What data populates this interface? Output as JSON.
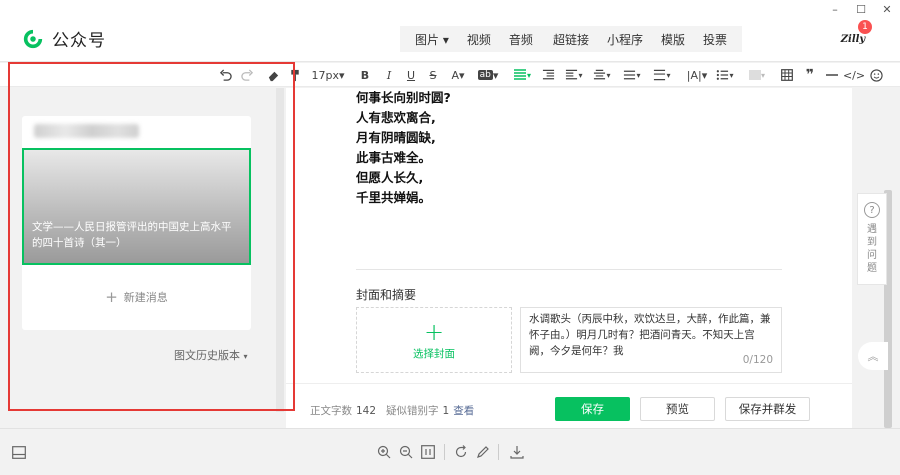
{
  "window": {
    "controls": [
      "–",
      "☐",
      "✕"
    ]
  },
  "header": {
    "app_name": "公众号",
    "media_group_1": [
      "图片",
      "视频",
      "音频"
    ],
    "media_group_2": [
      "超链接",
      "小程序",
      "模版",
      "投票"
    ],
    "avatar_text": "Zilly",
    "notification_count": "1"
  },
  "toolbar": {
    "font_size": "17px",
    "icons": [
      "undo-icon",
      "redo-icon",
      "eraser-icon",
      "format-painter-icon",
      "bold-icon",
      "italic-icon",
      "underline-icon",
      "strikethrough-icon",
      "font-color-icon",
      "highlight-icon",
      "align-left-icon",
      "indent-icon",
      "outdent-icon",
      "align-center-icon",
      "line-spacing-icon",
      "paragraph-spacing-icon",
      "letter-spacing-icon",
      "list-icon",
      "background-icon",
      "table-icon",
      "quote-icon",
      "divider-icon",
      "code-icon",
      "emoji-icon"
    ]
  },
  "sidebar": {
    "article_title": "文学——人民日报管评出的中国史上高水平的四十首诗（其一）",
    "new_message": "新建消息",
    "history": "图文历史版本"
  },
  "editor": {
    "poem_lines": [
      "何事长向别时圆?",
      "人有悲欢离合,",
      "月有阴晴圆缺,",
      "此事古难全。",
      "但愿人长久,",
      "千里共婵娟。"
    ],
    "cover_section_label": "封面和摘要",
    "select_cover": "选择封面",
    "summary_text": "水调歌头（丙辰中秋，欢饮达旦，大醉，作此篇，兼怀子由。）明月几时有？把酒问青天。不知天上宫阙，今夕是何年？我",
    "summary_count": "0/120"
  },
  "footer": {
    "word_count_label": "正文字数",
    "word_count": "142",
    "typo_label": "疑似错别字",
    "typo_count": "1",
    "view_link": "查看",
    "save": "保存",
    "preview": "预览",
    "save_publish": "保存并群发"
  },
  "help": {
    "label": "遇到问题"
  },
  "colors": {
    "accent": "#07c160",
    "highlight_box": "#e53935",
    "link": "#576b95",
    "badge": "#fa5151"
  }
}
